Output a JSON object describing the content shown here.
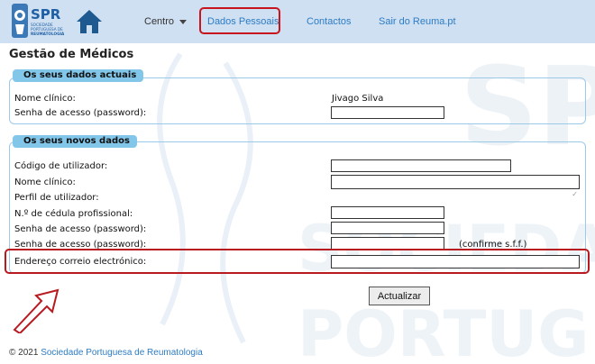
{
  "header": {
    "logo": {
      "abbr": "SPR",
      "line1": "SOCIEDADE",
      "line2": "PORTUGUESA DE",
      "line3": "REUMATOLOGIA"
    },
    "nav": [
      {
        "label": "Centro"
      },
      {
        "label": "Dados Pessoais"
      },
      {
        "label": "Contactos"
      },
      {
        "label": "Sair do Reuma.pt"
      }
    ]
  },
  "page": {
    "title": "Gestão de Médicos"
  },
  "current": {
    "legend": "Os seus dados actuais",
    "name_label": "Nome clínico:",
    "name_value": "Jivago Silva",
    "password_label": "Senha de acesso (password):",
    "password_value": ""
  },
  "new": {
    "legend": "Os seus novos dados",
    "fields": [
      {
        "label": "Código de utilizador:",
        "value": ""
      },
      {
        "label": "Nome clínico:",
        "value": ""
      },
      {
        "label": "Perfil de utilizador:",
        "value": ""
      },
      {
        "label": "N.º de cédula profissional:",
        "value": ""
      },
      {
        "label": "Senha de acesso (password):",
        "value": ""
      },
      {
        "label": "Senha de acesso (password):",
        "value": "",
        "hint": "(confirme s.f.f.)"
      },
      {
        "label": "Endereço correio electrónico:",
        "value": ""
      }
    ]
  },
  "submit_label": "Actualizar",
  "footer": {
    "copyright": "© 2021",
    "link": "Sociedade Portuguesa de Reumatologia"
  },
  "colors": {
    "accent": "#2d7cc4",
    "highlight": "#c8141c",
    "legend_bg": "#82c6ea",
    "topbar": "#cfe0f2"
  }
}
